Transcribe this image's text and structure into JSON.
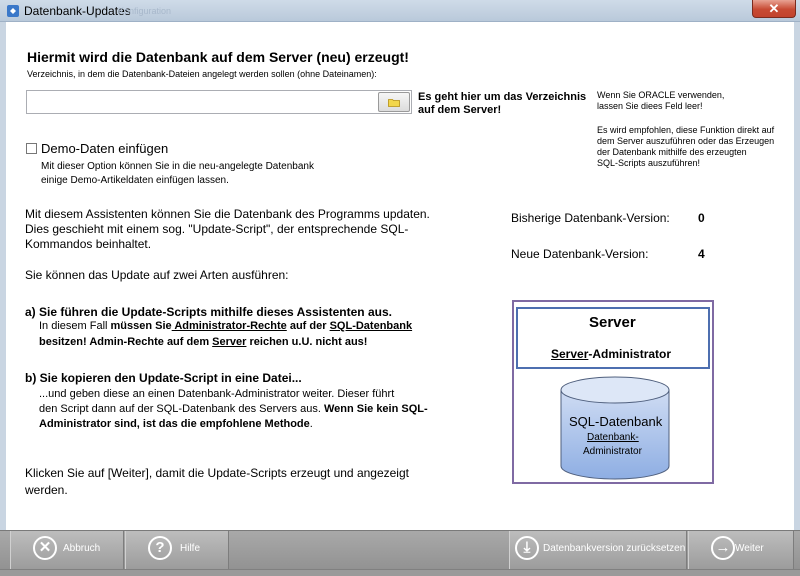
{
  "window": {
    "title": "Datenbank-Updates",
    "ghost_title": "Konfiguration",
    "close_symbol": "✕"
  },
  "header": {
    "heading": "Hiermit wird die Datenbank auf dem Server (neu) erzeugt!",
    "path_label": "Verzeichnis, in dem die Datenbank-Dateien angelegt werden sollen (ohne Dateinamen):",
    "path_value": "",
    "path_hint_line1": "Es geht hier um das Verzeichnis",
    "path_hint_line2": "auf dem Server!"
  },
  "oracle_note": {
    "line1": "Wenn Sie ORACLE verwenden,",
    "line2": "lassen Sie diees Feld leer!"
  },
  "server_note": {
    "line1": "Es wird empfohlen, diese Funktion direkt auf",
    "line2": "dem Server auszuführen oder das Erzeugen",
    "line3": "der Datenbank mithilfe des erzeugten",
    "line4": "SQL-Scripts auszuführen!"
  },
  "demo": {
    "label": "Demo-Daten einfügen",
    "checked": false,
    "desc_line1": "Mit dieser Option können Sie in die neu-angelegte Datenbank",
    "desc_line2": "einige Demo-Artikeldaten einfügen lassen."
  },
  "intro": {
    "line1": "Mit diesem Assistenten können Sie die Datenbank des Programms updaten.",
    "line2": "Dies geschieht mit einem sog. \"Update-Script\", der entsprechende SQL-",
    "line3": "Kommandos beinhaltet.",
    "line4": "Sie können das Update auf zwei Arten ausführen:"
  },
  "option_a": {
    "heading": "a) Sie führen die Update-Scripts mithilfe dieses Assistenten aus.",
    "l1_p1": "In diesem Fall ",
    "l1_p2": "müssen Sie",
    "l1_p3": " Administrator-Rechte",
    "l1_p4": " auf der ",
    "l1_p5": "SQL-Datenbank",
    "l2_p1": "besitzen! Admin-Rechte auf dem ",
    "l2_p2": "Server",
    "l2_p3": " reichen u.U. nicht aus!"
  },
  "option_b": {
    "heading": "b) Sie kopieren den Update-Script in eine Datei...",
    "line1": "...und geben diese an einen Datenbank-Administrator weiter. Dieser führt",
    "l2_p1": "den Script dann auf der SQL-Datenbank des Servers aus. ",
    "l2_p2": "Wenn Sie kein SQL-",
    "l3_p1": "Administrator sind, ist das die empfohlene Methode",
    "l3_p2": "."
  },
  "footer_text": {
    "line1": "Klicken Sie auf [Weiter], damit die Update-Scripts erzeugt und angezeigt",
    "line2": "werden."
  },
  "versions": {
    "current_label": "Bisherige Datenbank-Version:",
    "current_value": "0",
    "new_label": "Neue Datenbank-Version:",
    "new_value": "4"
  },
  "diagram": {
    "server_title": "Server",
    "server_admin_p1": "Server",
    "server_admin_p2": "-Administrator",
    "db_title": "SQL-Datenbank",
    "db_admin_line1": "Datenbank-",
    "db_admin_line2": "Administrator"
  },
  "buttons": {
    "cancel": {
      "label": "Abbruch",
      "icon": "✕"
    },
    "help": {
      "label": "Hilfe",
      "icon": "?"
    },
    "reset": {
      "label": "Datenbankversion zurücksetzen",
      "icon": "⤓"
    },
    "next": {
      "label": "Weiter",
      "icon": "→"
    }
  },
  "colors": {
    "diagram_outer_border": "#7f6aa3",
    "server_box_border": "#4d6fb0",
    "db_fill": "#a8c3ec",
    "bottom_bar": "#9c9c9c"
  }
}
